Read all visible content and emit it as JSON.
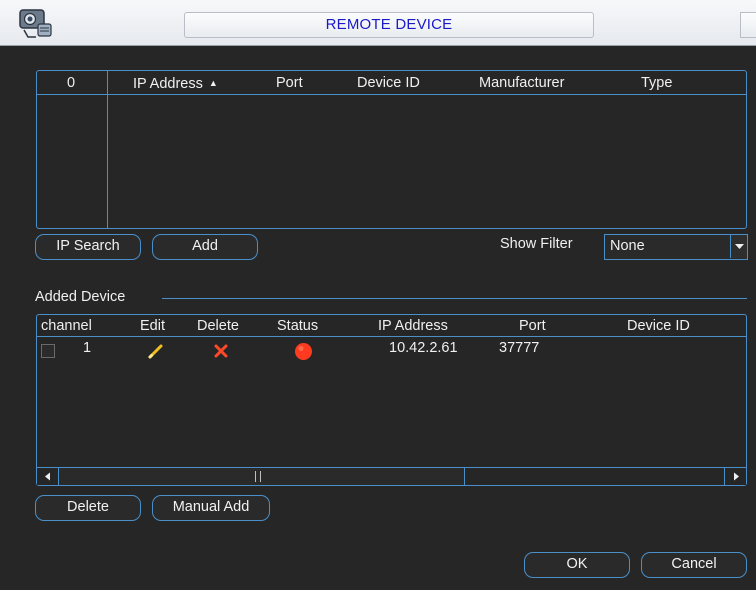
{
  "window": {
    "title": "REMOTE DEVICE",
    "icon": "camera-network-icon"
  },
  "device_list": {
    "columns": [
      "0",
      "IP Address",
      "Port",
      "Device ID",
      "Manufacturer",
      "Type"
    ],
    "sort_indicator": "▲",
    "rows": []
  },
  "buttons": {
    "ip_search": "IP Search",
    "add": "Add",
    "delete": "Delete",
    "manual_add": "Manual Add",
    "ok": "OK",
    "cancel": "Cancel"
  },
  "filter": {
    "label": "Show Filter",
    "value": "None"
  },
  "added_device": {
    "section_label": "Added Device",
    "columns": [
      "channel",
      "Edit",
      "Delete",
      "Status",
      "IP Address",
      "Port",
      "Device ID"
    ],
    "rows": [
      {
        "channel": "1",
        "edit_icon": "pencil-icon",
        "delete_icon": "x-icon",
        "status_icon": "red-dot-icon",
        "ip": "10.42.2.61",
        "port": "37777",
        "device_id": ""
      }
    ]
  },
  "colors": {
    "accent_border": "#4a8fc9",
    "title_text": "#1a1ac8",
    "background": "#262626",
    "status_offline": "#ff3b1f",
    "delete_x": "#ff4a2a",
    "edit_pencil": "#f0c020"
  }
}
